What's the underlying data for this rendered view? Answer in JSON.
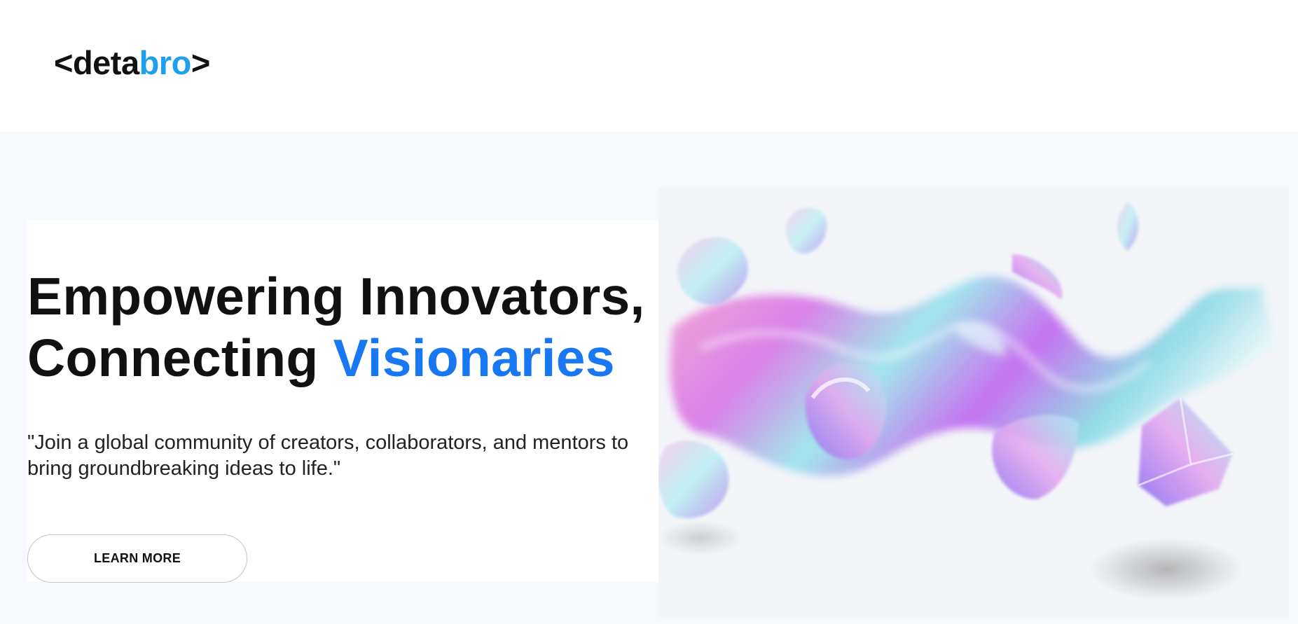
{
  "header": {
    "logo": {
      "open_bracket": "<",
      "word_dark": "deta",
      "word_blue": "bro",
      "close_bracket": ">"
    }
  },
  "hero": {
    "headline_line1": "Empowering Innovators,",
    "headline_line2_plain": "Connecting ",
    "headline_line2_accent": "Visionaries",
    "subtext": "\"Join a global community of creators, collaborators, and mentors to bring groundbreaking ideas to life.\"",
    "cta_label": "LEARN MORE",
    "illustration_icon": "abstract-3d-glass-shapes"
  },
  "colors": {
    "accent_blue": "#1877f2",
    "logo_blue": "#1ea0ef",
    "text_dark": "#111111",
    "hero_bg": "#f6f9fd"
  }
}
